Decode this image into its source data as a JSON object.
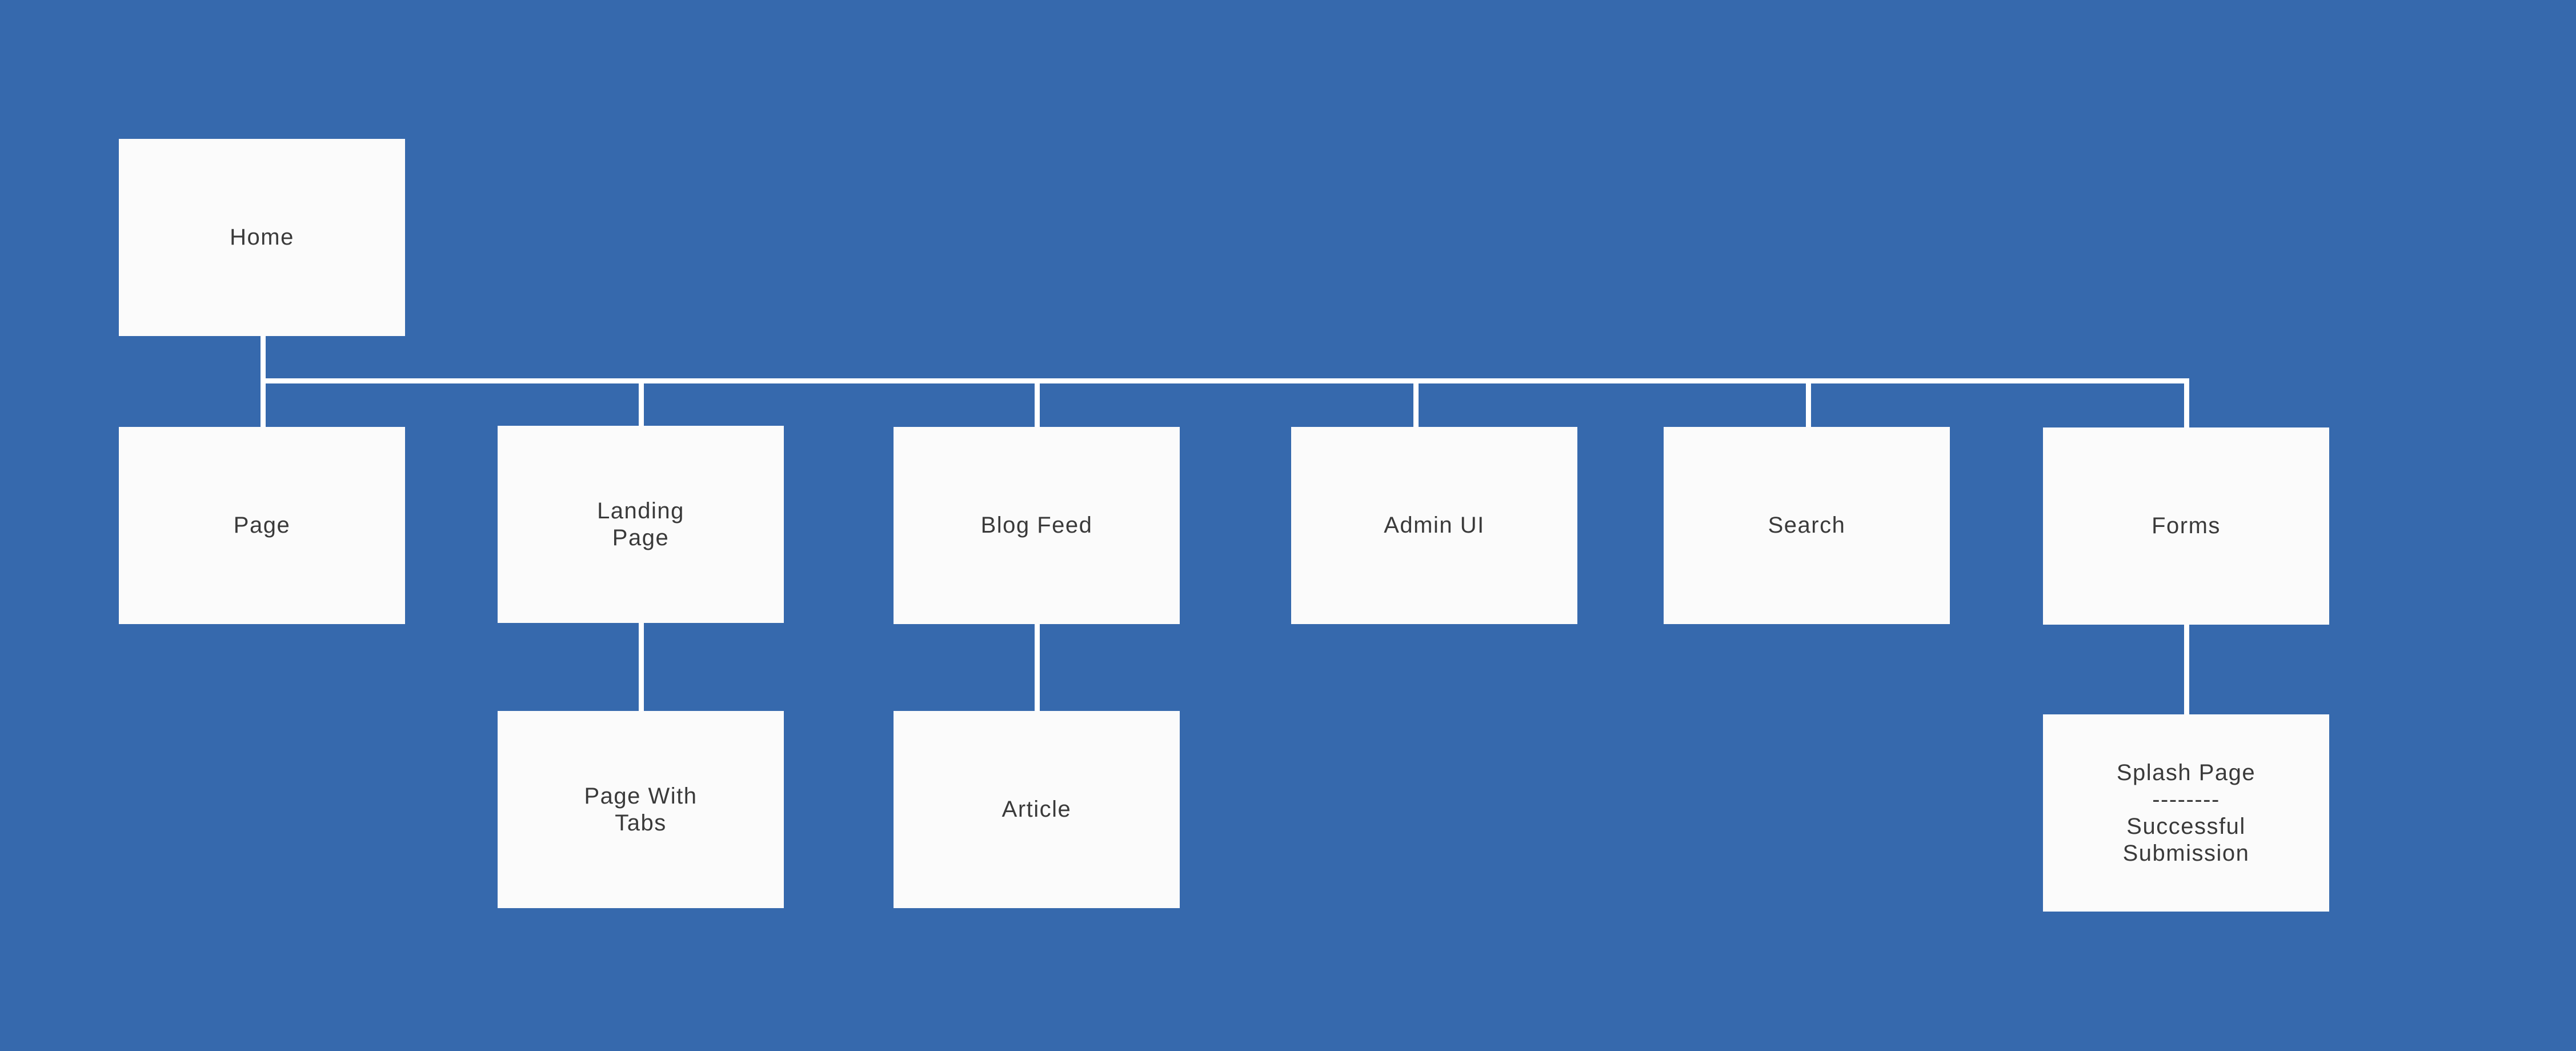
{
  "diagram": {
    "background_color": "#3669ad",
    "node_color": "#fbfbfb",
    "connector_color": "#ffffff",
    "text_color": "#3a3a3a",
    "nodes": {
      "home": "Home",
      "page": "Page",
      "landing_page": "Landing\nPage",
      "blog_feed": "Blog Feed",
      "admin_ui": "Admin UI",
      "search": "Search",
      "forms": "Forms",
      "page_with_tabs": "Page With\nTabs",
      "article": "Article",
      "splash_page": "Splash Page\n--------\nSuccessful\nSubmission"
    },
    "edges": [
      [
        "home",
        "page"
      ],
      [
        "home",
        "landing_page"
      ],
      [
        "home",
        "blog_feed"
      ],
      [
        "home",
        "admin_ui"
      ],
      [
        "home",
        "search"
      ],
      [
        "home",
        "forms"
      ],
      [
        "landing_page",
        "page_with_tabs"
      ],
      [
        "blog_feed",
        "article"
      ],
      [
        "forms",
        "splash_page"
      ]
    ]
  }
}
